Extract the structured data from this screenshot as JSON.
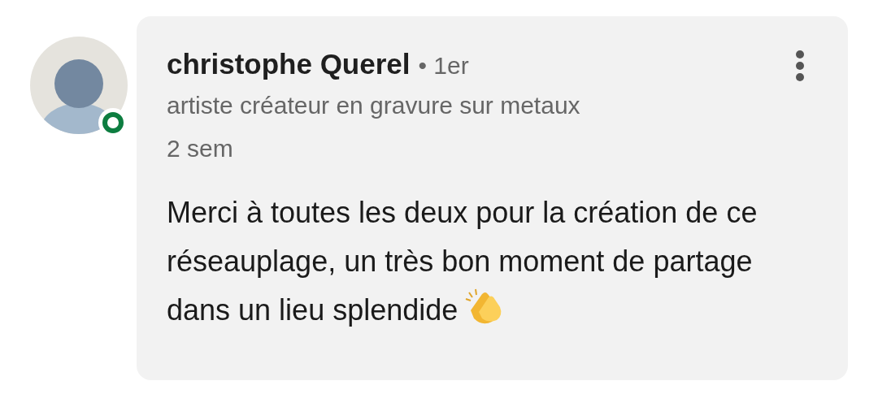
{
  "comment": {
    "author": "christophe Querel",
    "connection": "• 1er",
    "headline": "artiste créateur en gravure sur metaux",
    "time": "2 sem",
    "online": true,
    "body": "Merci à toutes les deux pour la création de ce réseauplage, un très bon moment de partage dans un lieu splendide"
  }
}
